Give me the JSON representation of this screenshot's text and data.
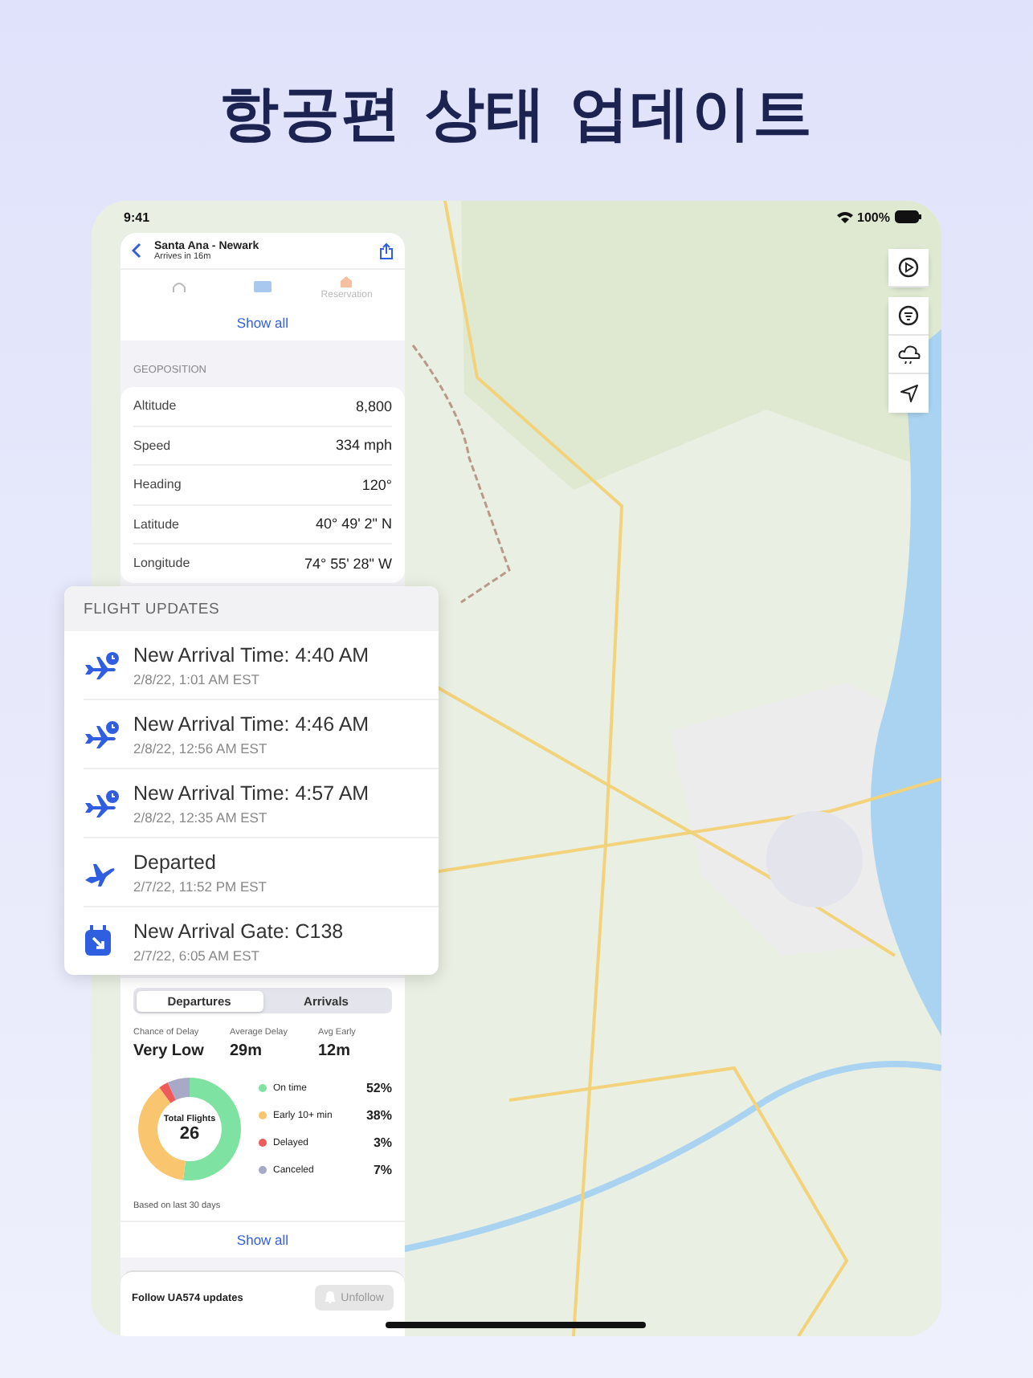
{
  "headline": "항공편 상태 업데이트",
  "status_bar": {
    "time": "9:41",
    "battery": "100%"
  },
  "sidebar": {
    "header": {
      "title": "Santa Ana - Newark",
      "subtitle": "Arrives in 16m"
    },
    "services": {
      "label": "Reservation"
    },
    "show_all_top": "Show all",
    "geoposition": {
      "heading": "GEOPOSITION",
      "rows": [
        {
          "label": "Altitude",
          "value": "8,800"
        },
        {
          "label": "Speed",
          "value": "334 mph"
        },
        {
          "label": "Heading",
          "value": "120°"
        },
        {
          "label": "Latitude",
          "value": "40° 49' 2\" N"
        },
        {
          "label": "Longitude",
          "value": "74° 55' 28\" W"
        }
      ]
    },
    "stats": {
      "tabs": [
        {
          "label": "Departures",
          "selected": true
        },
        {
          "label": "Arrivals",
          "selected": false
        }
      ],
      "metrics": [
        {
          "label": "Chance of Delay",
          "value": "Very Low"
        },
        {
          "label": "Average Delay",
          "value": "29m"
        },
        {
          "label": "Avg Early",
          "value": "12m"
        }
      ],
      "total_label": "Total Flights",
      "total_value": "26",
      "chart_data": {
        "type": "donut",
        "categories": [
          "On time",
          "Early 10+ min",
          "Delayed",
          "Canceled"
        ],
        "values": [
          52,
          38,
          3,
          7
        ]
      },
      "legend": [
        {
          "value": "52%",
          "color": "#7ee2a2"
        },
        {
          "value": "38%",
          "color": "#f9c56e"
        },
        {
          "value": "3%",
          "color": "#ef5b5b"
        },
        {
          "value": "7%",
          "color": "#a8a9c6"
        }
      ],
      "note": "Based on last 30 days",
      "show_all": "Show all"
    },
    "follow": {
      "label": "Follow UA574 updates",
      "button": "Unfollow"
    }
  },
  "flight_updates": {
    "heading": "FLIGHT UPDATES",
    "items": [
      {
        "kind": "time_change",
        "title": "New Arrival Time: 4:40 AM",
        "time": "2/8/22, 1:01 AM EST"
      },
      {
        "kind": "time_change",
        "title": "New Arrival Time: 4:46 AM",
        "time": "2/8/22, 12:56 AM EST"
      },
      {
        "kind": "time_change",
        "title": "New Arrival Time: 4:57 AM",
        "time": "2/8/22, 12:35 AM EST"
      },
      {
        "kind": "departed",
        "title": "Departed",
        "time": "2/7/22, 11:52 PM EST"
      },
      {
        "kind": "gate",
        "title": "New Arrival Gate: C138",
        "time": "2/7/22, 6:05 AM EST"
      }
    ]
  }
}
